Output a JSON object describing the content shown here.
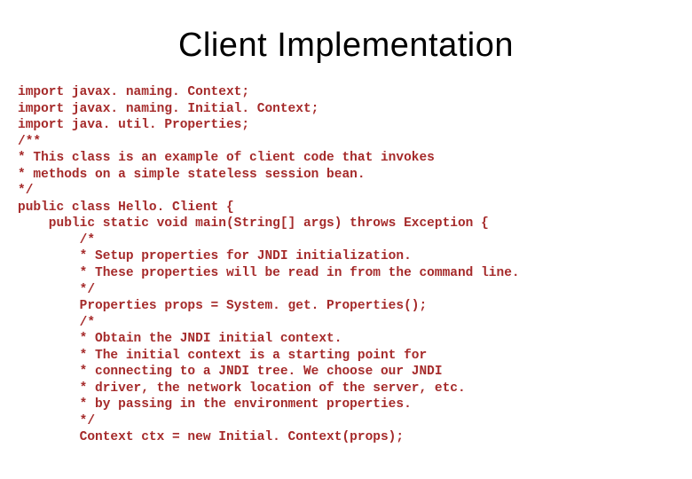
{
  "slide": {
    "title": "Client Implementation",
    "code_lines": [
      "import javax. naming. Context;",
      "import javax. naming. Initial. Context;",
      "import java. util. Properties;",
      "/**",
      "* This class is an example of client code that invokes",
      "* methods on a simple stateless session bean.",
      "*/",
      "public class Hello. Client {",
      "    public static void main(String[] args) throws Exception {",
      "        /*",
      "        * Setup properties for JNDI initialization.",
      "        * These properties will be read in from the command line.",
      "        */",
      "        Properties props = System. get. Properties();",
      "        /*",
      "        * Obtain the JNDI initial context.",
      "        * The initial context is a starting point for",
      "        * connecting to a JNDI tree. We choose our JNDI",
      "        * driver, the network location of the server, etc.",
      "        * by passing in the environment properties.",
      "        */",
      "        Context ctx = new Initial. Context(props);"
    ]
  }
}
